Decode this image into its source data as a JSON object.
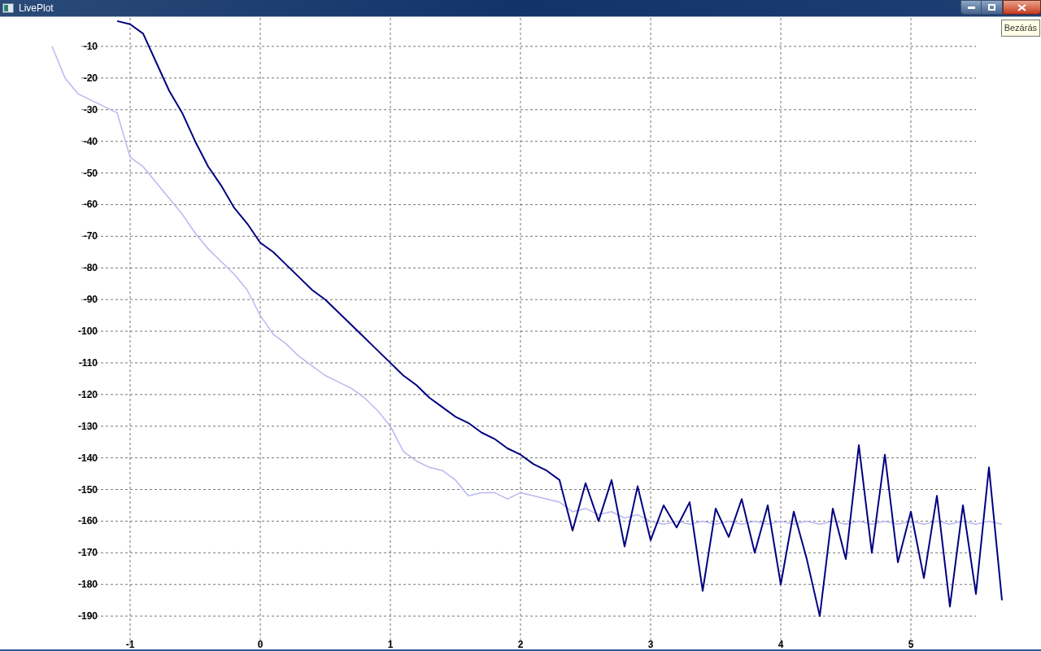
{
  "window": {
    "title": "LivePlot",
    "tooltip": "Bezárás"
  },
  "plot": {
    "chart_data": {
      "type": "line",
      "x": [
        -1.6,
        -1.5,
        -1.4,
        -1.3,
        -1.2,
        -1.1,
        -1.0,
        -0.9,
        -0.8,
        -0.7,
        -0.6,
        -0.5,
        -0.4,
        -0.3,
        -0.2,
        -0.1,
        0,
        0.1,
        0.2,
        0.3,
        0.4,
        0.5,
        0.6,
        0.7,
        0.8,
        0.9,
        1.0,
        1.1,
        1.2,
        1.3,
        1.4,
        1.5,
        1.6,
        1.7,
        1.8,
        1.9,
        2.0,
        2.1,
        2.2,
        2.3,
        2.4,
        2.5,
        2.6,
        2.7,
        2.8,
        2.9,
        3.0,
        3.1,
        3.2,
        3.3,
        3.4,
        3.5,
        3.6,
        3.7,
        3.8,
        3.9,
        4.0,
        4.1,
        4.2,
        4.3,
        4.4,
        4.5,
        4.6,
        4.7,
        4.8,
        4.9,
        5.0,
        5.1,
        5.2,
        5.3,
        5.4,
        5.5,
        5.6,
        5.7
      ],
      "series": [
        {
          "color": "#b8b8f0",
          "values": [
            -10,
            -20,
            -25,
            -27,
            -29,
            -31,
            -45,
            -48,
            -53,
            -58,
            -63,
            -69,
            -74,
            -78,
            -82,
            -87,
            -95,
            -101,
            -104,
            -108,
            -111,
            -114,
            -116,
            -118,
            -121,
            -125,
            -130,
            -138,
            -141,
            -143,
            -144,
            -147,
            -152,
            -151,
            -151,
            -153,
            -151,
            -152,
            -153,
            -154,
            -157,
            -156,
            -158,
            -157,
            -159,
            -158,
            -160,
            -161,
            -160,
            -161,
            -160,
            -161,
            -160,
            -161,
            -160,
            -161,
            -160,
            -161,
            -160,
            -161,
            -160,
            -161,
            -160,
            -161,
            -160,
            -161,
            -160,
            -161,
            -160,
            -161,
            -160,
            -161,
            -160,
            -161
          ]
        },
        {
          "color": "#000080",
          "values": [
            null,
            null,
            null,
            null,
            null,
            -2,
            -3,
            -6,
            -15,
            -24,
            -31,
            -40,
            -48,
            -54,
            -61,
            -66,
            -72,
            -75,
            -79,
            -83,
            -87,
            -90,
            -94,
            -98,
            -102,
            -106,
            -110,
            -114,
            -117,
            -121,
            -124,
            -127,
            -129,
            -132,
            -134,
            -137,
            -139,
            -142,
            -144,
            -147,
            -163,
            -148,
            -160,
            -147,
            -168,
            -149,
            -166,
            -155,
            -162,
            -154,
            -182,
            -156,
            -165,
            -153,
            -170,
            -155,
            -180,
            -157,
            -172,
            -190,
            -156,
            -172,
            -136,
            -170,
            -139,
            -173,
            -157,
            -178,
            -152,
            -187,
            -155,
            -183,
            -143,
            -185
          ]
        }
      ],
      "xlim": [
        -2,
        6
      ],
      "ylim": [
        -200,
        -1
      ],
      "grid": true,
      "xticks": [
        -1,
        0,
        1,
        2,
        3,
        4,
        5
      ],
      "yticks": [
        -10,
        -20,
        -30,
        -40,
        -50,
        -60,
        -70,
        -80,
        -90,
        -100,
        -110,
        -120,
        -130,
        -140,
        -150,
        -160,
        -170,
        -180,
        -190
      ]
    }
  }
}
